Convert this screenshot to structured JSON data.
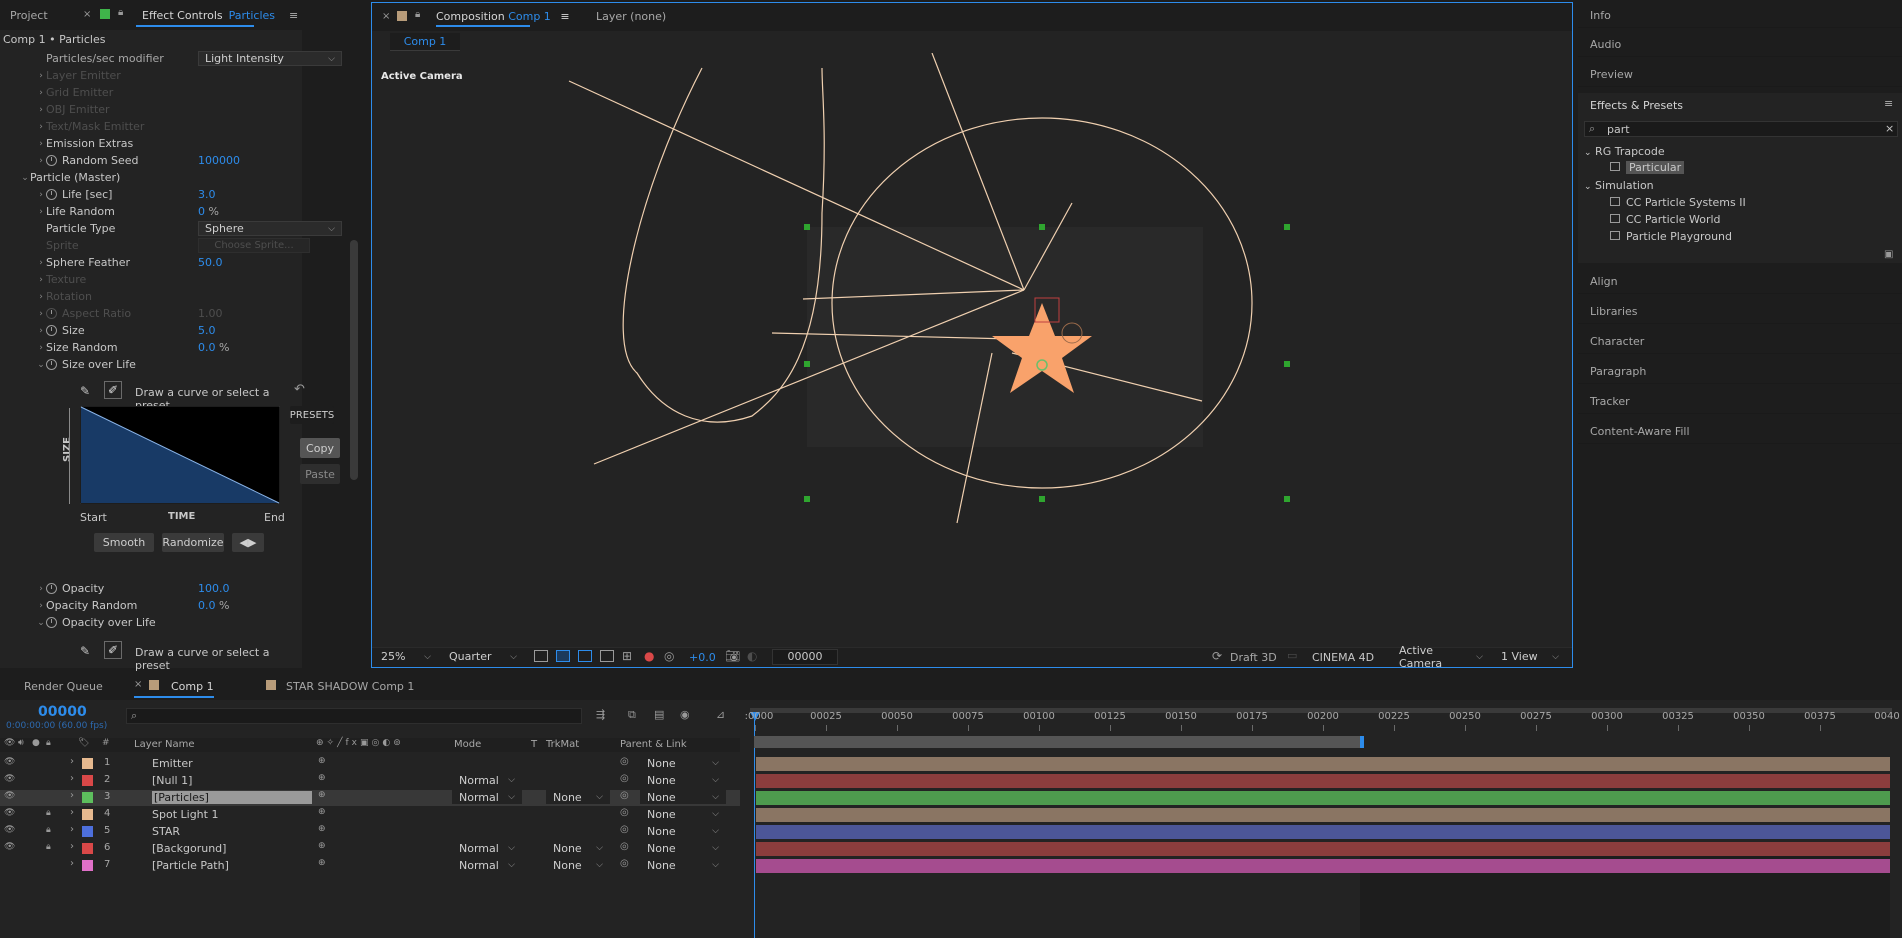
{
  "effect_panel": {
    "tab_project": "Project",
    "tab_effect": "Effect Controls",
    "tab_effect_layer": "Particles",
    "breadcrumb": "Comp 1 • Particles",
    "rows": [
      {
        "label": "Particles/sec modifier",
        "dropdown": "Light Intensity"
      },
      {
        "label": "Layer Emitter"
      },
      {
        "label": "Grid Emitter"
      },
      {
        "label": "OBJ Emitter"
      },
      {
        "label": "Text/Mask Emitter"
      },
      {
        "label": "Emission Extras"
      },
      {
        "label": "Random Seed",
        "value": "100000"
      },
      {
        "label": "Particle (Master)"
      },
      {
        "label": "Life [sec]",
        "value": "3.0"
      },
      {
        "label": "Life Random",
        "value": "0",
        "unit": "%"
      },
      {
        "label": "Particle Type",
        "dropdown": "Sphere"
      },
      {
        "label": "Sprite",
        "dropdown": "Choose Sprite..."
      },
      {
        "label": "Sphere Feather",
        "value": "50.0"
      },
      {
        "label": "Texture"
      },
      {
        "label": "Rotation"
      },
      {
        "label": "Aspect Ratio",
        "value": "1.00"
      },
      {
        "label": "Size",
        "value": "5.0"
      },
      {
        "label": "Size Random",
        "value": "0.0",
        "unit": "%"
      },
      {
        "label": "Size over Life"
      },
      {
        "label": "Opacity",
        "value": "100.0"
      },
      {
        "label": "Opacity Random",
        "value": "0.0",
        "unit": "%"
      },
      {
        "label": "Opacity over Life"
      }
    ],
    "curve_hint": "Draw a curve or select a preset",
    "presets_label": "PRESETS",
    "copy_label": "Copy",
    "paste_label": "Paste",
    "axis_y": "SIZE",
    "axis_x": "TIME",
    "start_label": "Start",
    "end_label": "End",
    "smooth_label": "Smooth",
    "randomize_label": "Randomize",
    "curve_hint_2": "Draw a curve or select a preset"
  },
  "comp_panel": {
    "tab_comp": "Composition",
    "tab_comp_name": "Comp 1",
    "tab_layer": "Layer",
    "tab_layer_value": "(none)",
    "sub_tab": "Comp 1",
    "camera_label": "Active Camera",
    "zoom": "25%",
    "resolution": "Quarter",
    "exposure": "+0.0",
    "timecode": "00000",
    "renderer_mode": "Draft 3D",
    "renderer": "CINEMA 4D",
    "camera_select": "Active Camera",
    "view_select": "1 View"
  },
  "right_panel": {
    "info": "Info",
    "audio": "Audio",
    "preview": "Preview",
    "effects_presets": "Effects & Presets",
    "search_value": "part",
    "group1": "RG Trapcode",
    "group1_items": [
      "Particular"
    ],
    "group2": "Simulation",
    "group2_items": [
      "CC Particle Systems II",
      "CC Particle World",
      "Particle Playground"
    ],
    "align": "Align",
    "libraries": "Libraries",
    "character": "Character",
    "paragraph": "Paragraph",
    "tracker": "Tracker",
    "content_aware_fill": "Content-Aware Fill"
  },
  "timeline": {
    "tab_render_queue": "Render Queue",
    "tab_comp1": "Comp 1",
    "tab_star_shadow": "STAR SHADOW Comp 1",
    "current_frame": "00000",
    "current_time": "0:00:00:00 (60.00 fps)",
    "search_placeholder": "",
    "col_layer_name": "Layer Name",
    "col_mode": "Mode",
    "col_t": "T",
    "col_trkmat": "TrkMat",
    "col_parent": "Parent & Link",
    "ruler": [
      "00025",
      "00050",
      "00075",
      "00100",
      "00125",
      "00150",
      "00175",
      "00200",
      "00225",
      "00250",
      "00275",
      "00300",
      "00325",
      "00350",
      "00375"
    ],
    "ruler_start": ":0000",
    "ruler_end": "0040",
    "layers": [
      {
        "num": "1",
        "name": "Emitter",
        "mode": "",
        "trkmat": "",
        "parent": "None",
        "color": "#e6b98f",
        "bar": "#8a7563"
      },
      {
        "num": "2",
        "name": "[Null 1]",
        "mode": "Normal",
        "trkmat": "",
        "parent": "None",
        "color": "#d94848",
        "bar": "#8b3d3d"
      },
      {
        "num": "3",
        "name": "[Particles]",
        "mode": "Normal",
        "trkmat": "None",
        "parent": "None",
        "color": "#5dbe5d",
        "bar": "#4e9b4e"
      },
      {
        "num": "4",
        "name": "Spot Light 1",
        "mode": "",
        "trkmat": "",
        "parent": "None",
        "color": "#e6b98f",
        "bar": "#8a7563"
      },
      {
        "num": "5",
        "name": "STAR",
        "mode": "",
        "trkmat": "",
        "parent": "None",
        "color": "#4d6fdc",
        "bar": "#4c5698"
      },
      {
        "num": "6",
        "name": "[Backgorund]",
        "mode": "Normal",
        "trkmat": "None",
        "parent": "None",
        "color": "#d94848",
        "bar": "#8b3d3d"
      },
      {
        "num": "7",
        "name": "[Particle Path]",
        "mode": "Normal",
        "trkmat": "None",
        "parent": "None",
        "color": "#e070c8",
        "bar": "#a54c8f"
      }
    ]
  },
  "colors": {
    "accent": "#2d8ceb",
    "star": "#f9a26b",
    "path": "#f0d0b0"
  }
}
